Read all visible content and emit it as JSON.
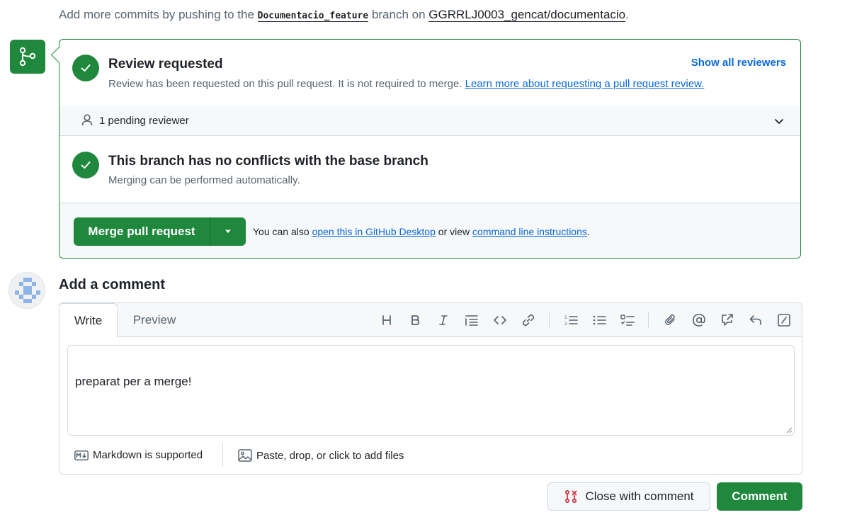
{
  "top_hint": {
    "prefix": "Add more commits by pushing to the",
    "branch": "Documentacio_feature",
    "middle": "branch on",
    "repo": "GGRRLJ0003_gencat/documentacio",
    "suffix": "."
  },
  "review": {
    "title": "Review requested",
    "subtitle": "Review has been requested on this pull request. It is not required to merge.",
    "learn_link": "Learn more about requesting a pull request review.",
    "show_all": "Show all reviewers",
    "pending": "1 pending reviewer"
  },
  "conflicts": {
    "title": "This branch has no conflicts with the base branch",
    "subtitle": "Merging can be performed automatically."
  },
  "merge": {
    "button": "Merge pull request",
    "also_prefix": "You can also",
    "desktop_link": "open this in GitHub Desktop",
    "or_view": "or view",
    "cli_link": "command line instructions",
    "suffix": "."
  },
  "comment": {
    "heading": "Add a comment",
    "tabs": [
      "Write",
      "Preview"
    ],
    "text": "preparat per a merge!",
    "markdown": "Markdown is supported",
    "files": "Paste, drop, or click to add files",
    "toolbar_icons": [
      "heading-icon",
      "bold-icon",
      "italic-icon",
      "quote-icon",
      "code-icon",
      "link-icon",
      "numbered-list-icon",
      "unordered-list-icon",
      "task-list-icon",
      "attach-icon",
      "mention-icon",
      "reference-icon",
      "undo-icon",
      "slash-command-icon"
    ]
  },
  "actions": {
    "close_with_comment": "Close with comment",
    "comment": "Comment"
  },
  "colors": {
    "success": "#1f883d",
    "link": "#0969da",
    "danger": "#cf222e",
    "muted": "#59636e"
  }
}
